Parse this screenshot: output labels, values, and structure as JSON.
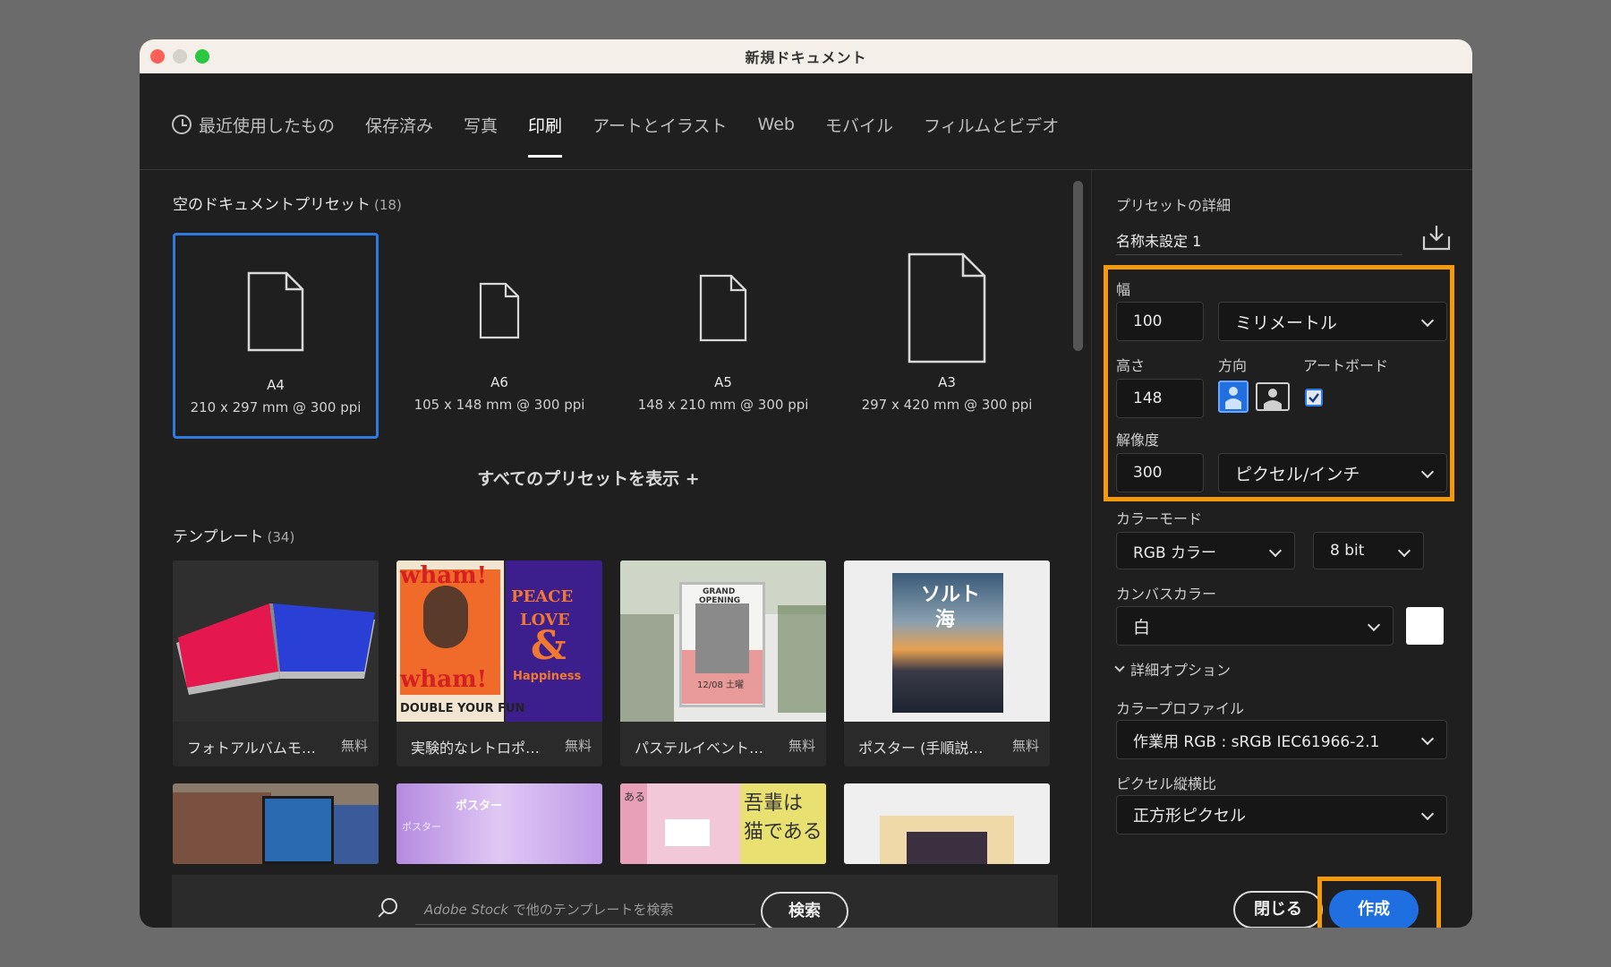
{
  "window": {
    "title": "新規ドキュメント"
  },
  "tabs": [
    {
      "label": "最近使用したもの",
      "icon": "clock-icon"
    },
    {
      "label": "保存済み"
    },
    {
      "label": "写真"
    },
    {
      "label": "印刷",
      "active": true
    },
    {
      "label": "アートとイラスト"
    },
    {
      "label": "Web"
    },
    {
      "label": "モバイル"
    },
    {
      "label": "フィルムとビデオ"
    }
  ],
  "presets": {
    "title": "空のドキュメントプリセット",
    "count": "(18)",
    "items": [
      {
        "name": "A4",
        "dims": "210 x 297 mm @ 300 ppi",
        "selected": true
      },
      {
        "name": "A6",
        "dims": "105 x 148 mm @ 300 ppi"
      },
      {
        "name": "A5",
        "dims": "148 x 210 mm @ 300 ppi"
      },
      {
        "name": "A3",
        "dims": "297 x 420 mm @ 300 ppi"
      }
    ],
    "show_all": "すべてのプリセットを表示 +"
  },
  "templates": {
    "title": "テンプレート",
    "count": "(34)",
    "items": [
      {
        "name": "フォトアルバムモ…",
        "price": "無料"
      },
      {
        "name": "実験的なレトロポ…",
        "price": "無料"
      },
      {
        "name": "パステルイベント…",
        "price": "無料"
      },
      {
        "name": "ポスター (手順説…",
        "price": "無料"
      }
    ],
    "thumb_text": {
      "wham": "wham!",
      "double": "DOUBLE YOUR FUN",
      "peace": "PEACE",
      "love": "LOVE",
      "amp": "&",
      "happiness": "Happiness",
      "grand": "GRAND",
      "opening": "OPENING",
      "date": "12/08 土曜",
      "solt": "ソルト",
      "umi": "海",
      "poster": "ポスター",
      "aru": "ある",
      "wagahai": "吾輩は",
      "neko": "猫である"
    }
  },
  "search": {
    "placeholder_brand": "Adobe Stock",
    "placeholder_rest": " で他のテンプレートを検索",
    "button": "検索"
  },
  "details": {
    "title": "プリセットの詳細",
    "doc_name": "名称未設定 1",
    "width_label": "幅",
    "width_value": "100",
    "unit": "ミリメートル",
    "height_label": "高さ",
    "height_value": "148",
    "orientation_label": "方向",
    "artboard_label": "アートボード",
    "resolution_label": "解像度",
    "resolution_value": "300",
    "resolution_unit": "ピクセル/インチ",
    "color_mode_label": "カラーモード",
    "color_mode": "RGB カラー",
    "bit_depth": "8 bit",
    "canvas_label": "カンバスカラー",
    "canvas_value": "白",
    "advanced_label": "詳細オプション",
    "profile_label": "カラープロファイル",
    "profile_value": "作業用 RGB : sRGB IEC61966-2.1",
    "pixel_ratio_label": "ピクセル縦横比",
    "pixel_ratio_value": "正方形ピクセル"
  },
  "buttons": {
    "close": "閉じる",
    "create": "作成"
  },
  "colors": {
    "accent": "#2d7ae0",
    "highlight": "#f59a0b",
    "create_bg": "#1f6fe0"
  }
}
